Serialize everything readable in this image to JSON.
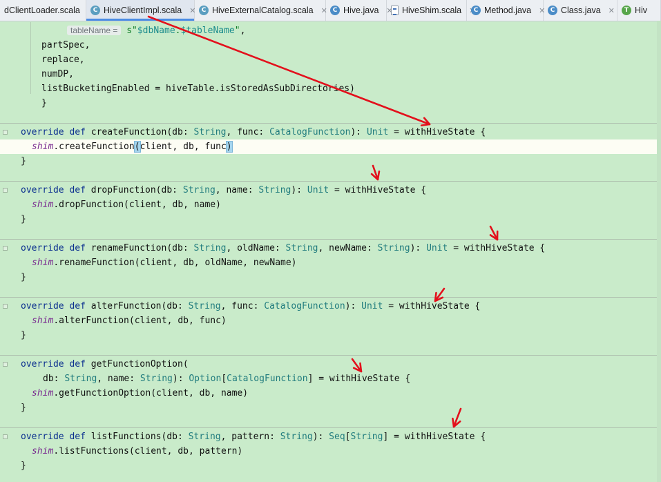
{
  "tabs": [
    {
      "label": "dClientLoader.scala",
      "icon": "scala-object-icon",
      "close": "✕",
      "active": false
    },
    {
      "label": "HiveClientImpl.scala",
      "icon": "scala-class-icon",
      "close": "✕",
      "active": true
    },
    {
      "label": "HiveExternalCatalog.scala",
      "icon": "scala-class-icon",
      "close": "✕",
      "active": false
    },
    {
      "label": "Hive.java",
      "icon": "java-class-icon",
      "close": "✕",
      "active": false
    },
    {
      "label": "HiveShim.scala",
      "icon": "scala-file-icon",
      "close": "✕",
      "active": false
    },
    {
      "label": "Method.java",
      "icon": "java-class-icon",
      "close": "✕",
      "active": false
    },
    {
      "label": "Class.java",
      "icon": "java-class-icon",
      "close": "✕",
      "active": false
    },
    {
      "label": "Hiv",
      "icon": "trait-icon",
      "close": "",
      "active": false
    }
  ],
  "editor": {
    "param_hint": "tableName =",
    "lines": [
      {
        "t": "s\"$dbName.$tableName\","
      },
      {
        "t": "partSpec,"
      },
      {
        "t": "replace,"
      },
      {
        "t": "numDP,"
      },
      {
        "t": "listBucketingEnabled = hiveTable.isStoredAsSubDirectories)"
      },
      {
        "t": "}"
      },
      {
        "t": "override def createFunction(db: String, func: CatalogFunction): Unit = withHiveState {"
      },
      {
        "t": "shim.createFunction(client, db, func)"
      },
      {
        "t": "}"
      },
      {
        "t": "override def dropFunction(db: String, name: String): Unit = withHiveState {"
      },
      {
        "t": "shim.dropFunction(client, db, name)"
      },
      {
        "t": "}"
      },
      {
        "t": "override def renameFunction(db: String, oldName: String, newName: String): Unit = withHiveState {"
      },
      {
        "t": "shim.renameFunction(client, db, oldName, newName)"
      },
      {
        "t": "}"
      },
      {
        "t": "override def alterFunction(db: String, func: CatalogFunction): Unit = withHiveState {"
      },
      {
        "t": "shim.alterFunction(client, db, func)"
      },
      {
        "t": "}"
      },
      {
        "t": "override def getFunctionOption("
      },
      {
        "t": "db: String, name: String): Option[CatalogFunction] = withHiveState {"
      },
      {
        "t": "shim.getFunctionOption(client, db, name)"
      },
      {
        "t": "}"
      },
      {
        "t": "override def listFunctions(db: String, pattern: String): Seq[String] = withHiveState {"
      },
      {
        "t": "shim.listFunctions(client, db, pattern)"
      },
      {
        "t": "}"
      }
    ]
  },
  "colors": {
    "editor_background": "#c9ebca",
    "keyword": "#0b2f8f",
    "type": "#217c7e",
    "object": "#7a2c90",
    "annotation_arrow": "#e3101c",
    "active_tab_underline": "#4a8be4"
  }
}
